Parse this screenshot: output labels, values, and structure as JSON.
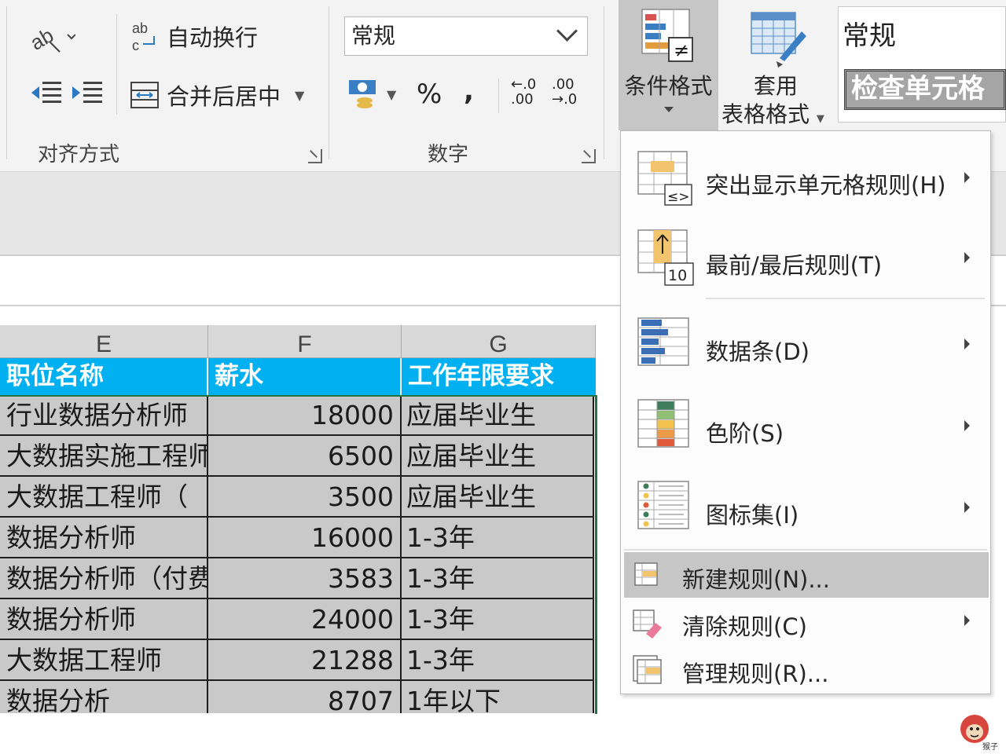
{
  "ribbon": {
    "align_group": {
      "wrap_text": "自动换行",
      "merge_center": "合并后居中",
      "label": "对齐方式"
    },
    "number_group": {
      "format_value": "常规",
      "percent": "%",
      "comma": ",",
      "inc_decimal_top": "←.0",
      "inc_decimal_bottom": ".00",
      "dec_decimal_top": ".00",
      "dec_decimal_bottom": "→.0",
      "label": "数字"
    },
    "conditional_format": "条件格式",
    "format_as_table": {
      "line1": "套用",
      "line2": "表格格式"
    },
    "styles": {
      "normal": "常规",
      "check_cell": "检查单元格"
    }
  },
  "sheet": {
    "columns": [
      "E",
      "F",
      "G"
    ],
    "header": [
      "职位名称",
      "薪水",
      "工作年限要求"
    ],
    "rows": [
      [
        "行业数据分析师",
        "18000",
        "应届毕业生"
      ],
      [
        "大数据实施工程师",
        "6500",
        "应届毕业生"
      ],
      [
        "大数据工程师（",
        "3500",
        "应届毕业生"
      ],
      [
        "数据分析师",
        "16000",
        "1-3年"
      ],
      [
        "数据分析师（付费",
        "3583",
        "1-3年"
      ],
      [
        "数据分析师",
        "24000",
        "1-3年"
      ],
      [
        "大数据工程师",
        "21288",
        "1-3年"
      ],
      [
        "数据分析",
        "8707",
        "1年以下"
      ]
    ]
  },
  "menu": {
    "items": [
      {
        "label": "突出显示单元格规则(H)",
        "icon": "highlight-rules-icon"
      },
      {
        "label": "最前/最后规则(T)",
        "icon": "top-bottom-rules-icon"
      },
      {
        "label": "数据条(D)",
        "icon": "data-bars-icon"
      },
      {
        "label": "色阶(S)",
        "icon": "color-scales-icon"
      },
      {
        "label": "图标集(I)",
        "icon": "icon-sets-icon"
      }
    ],
    "new_rule": "新建规则(N)...",
    "clear_rules": "清除规则(C)",
    "manage_rules": "管理规则(R)..."
  },
  "watermark": "猴子",
  "colors": {
    "header_fill": "#00b0f0",
    "cell_fill": "#c9c9c9",
    "selection": "#217346",
    "menu_highlight": "#c6c6c6",
    "style_check_fill": "#a5a5a5"
  }
}
